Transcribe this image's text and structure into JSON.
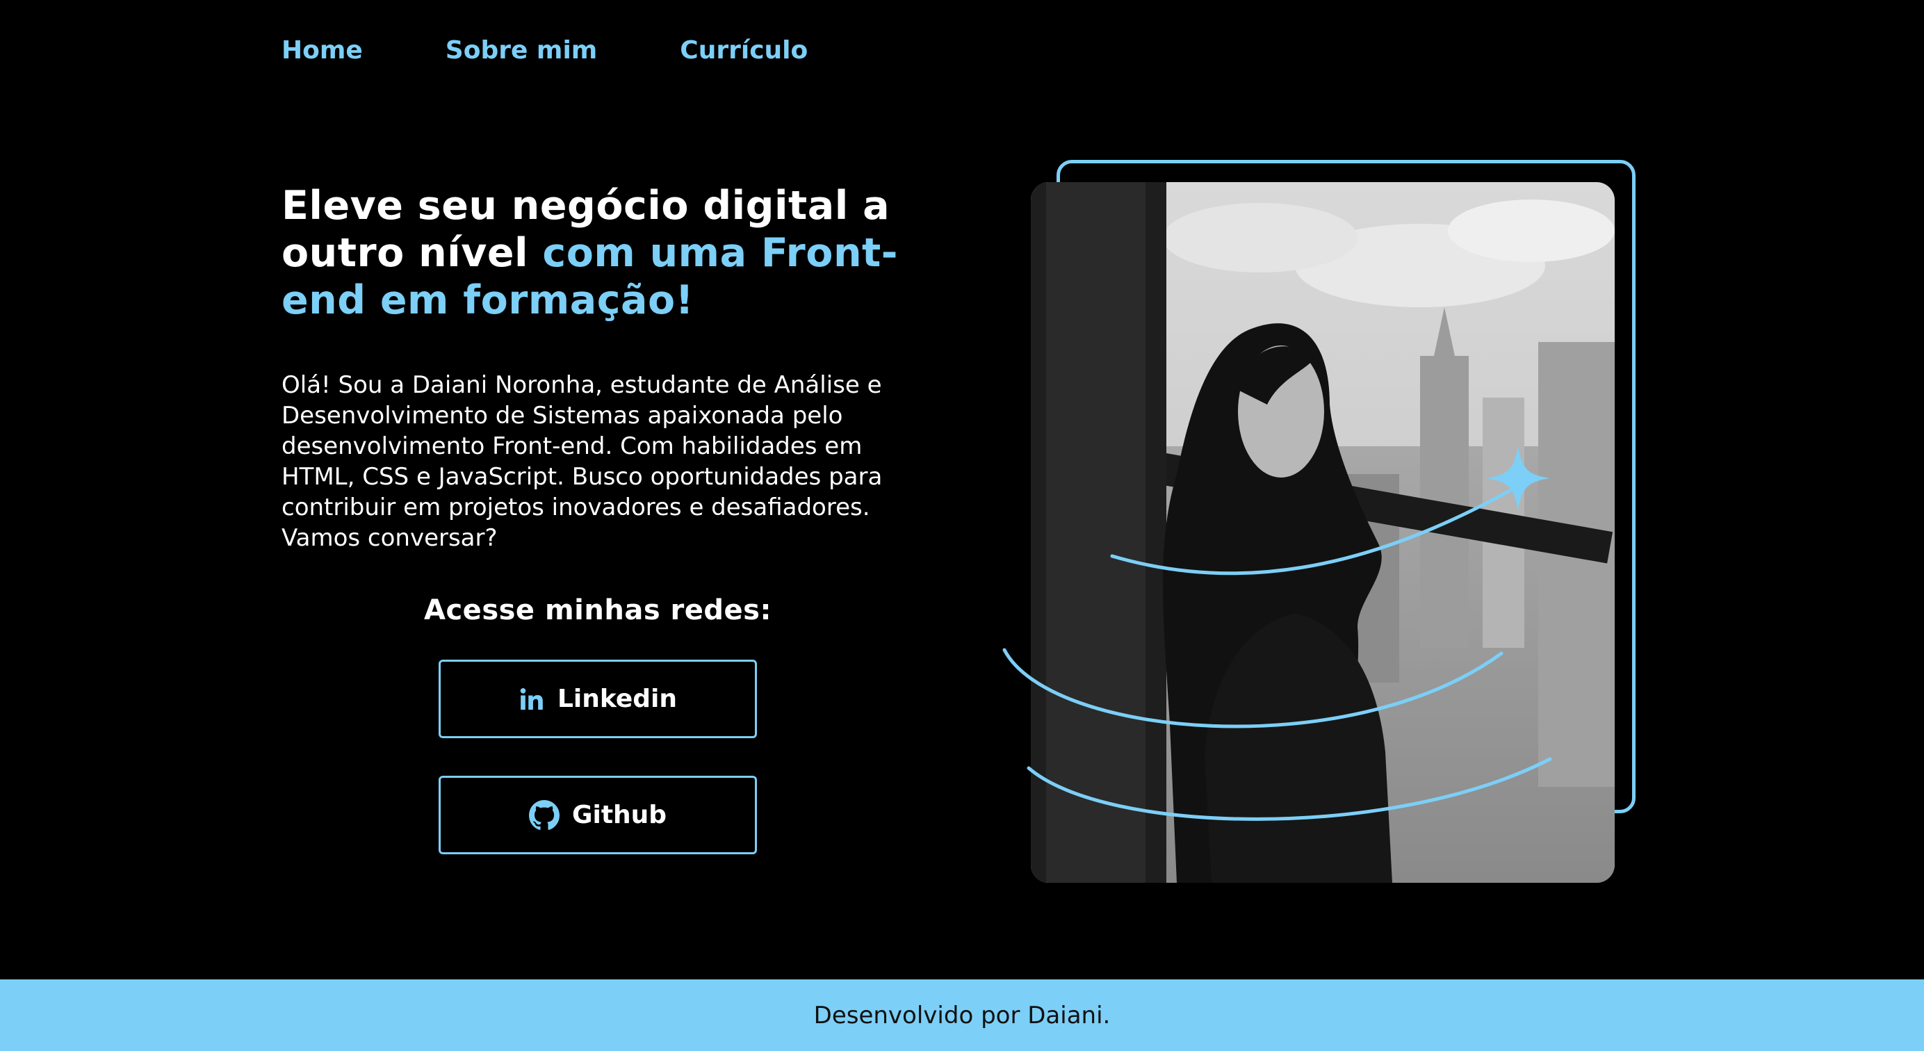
{
  "nav": {
    "items": [
      "Home",
      "Sobre mim",
      "Currículo"
    ]
  },
  "hero": {
    "title_white": "Eleve seu negócio digital a outro nível ",
    "title_accent": "com uma Front-end em formação!",
    "intro": "Olá! Sou a Daiani Noronha, estudante de Análise e Desenvolvimento de Sistemas apaixonada pelo desenvolvimento Front-end. Com habilidades em HTML, CSS e JavaScript. Busco oportunidades para contribuir em projetos inovadores e desafiadores. Vamos conversar?"
  },
  "social": {
    "heading": "Acesse minhas redes:",
    "linkedin_label": "Linkedin",
    "linkedin_icon": "linkedin-icon",
    "github_label": "Github",
    "github_icon": "github-icon"
  },
  "footer": {
    "text": "Desenvolvido por Daiani."
  },
  "colors": {
    "accent": "#7ccff7",
    "background": "#000000",
    "text": "#ffffff"
  }
}
